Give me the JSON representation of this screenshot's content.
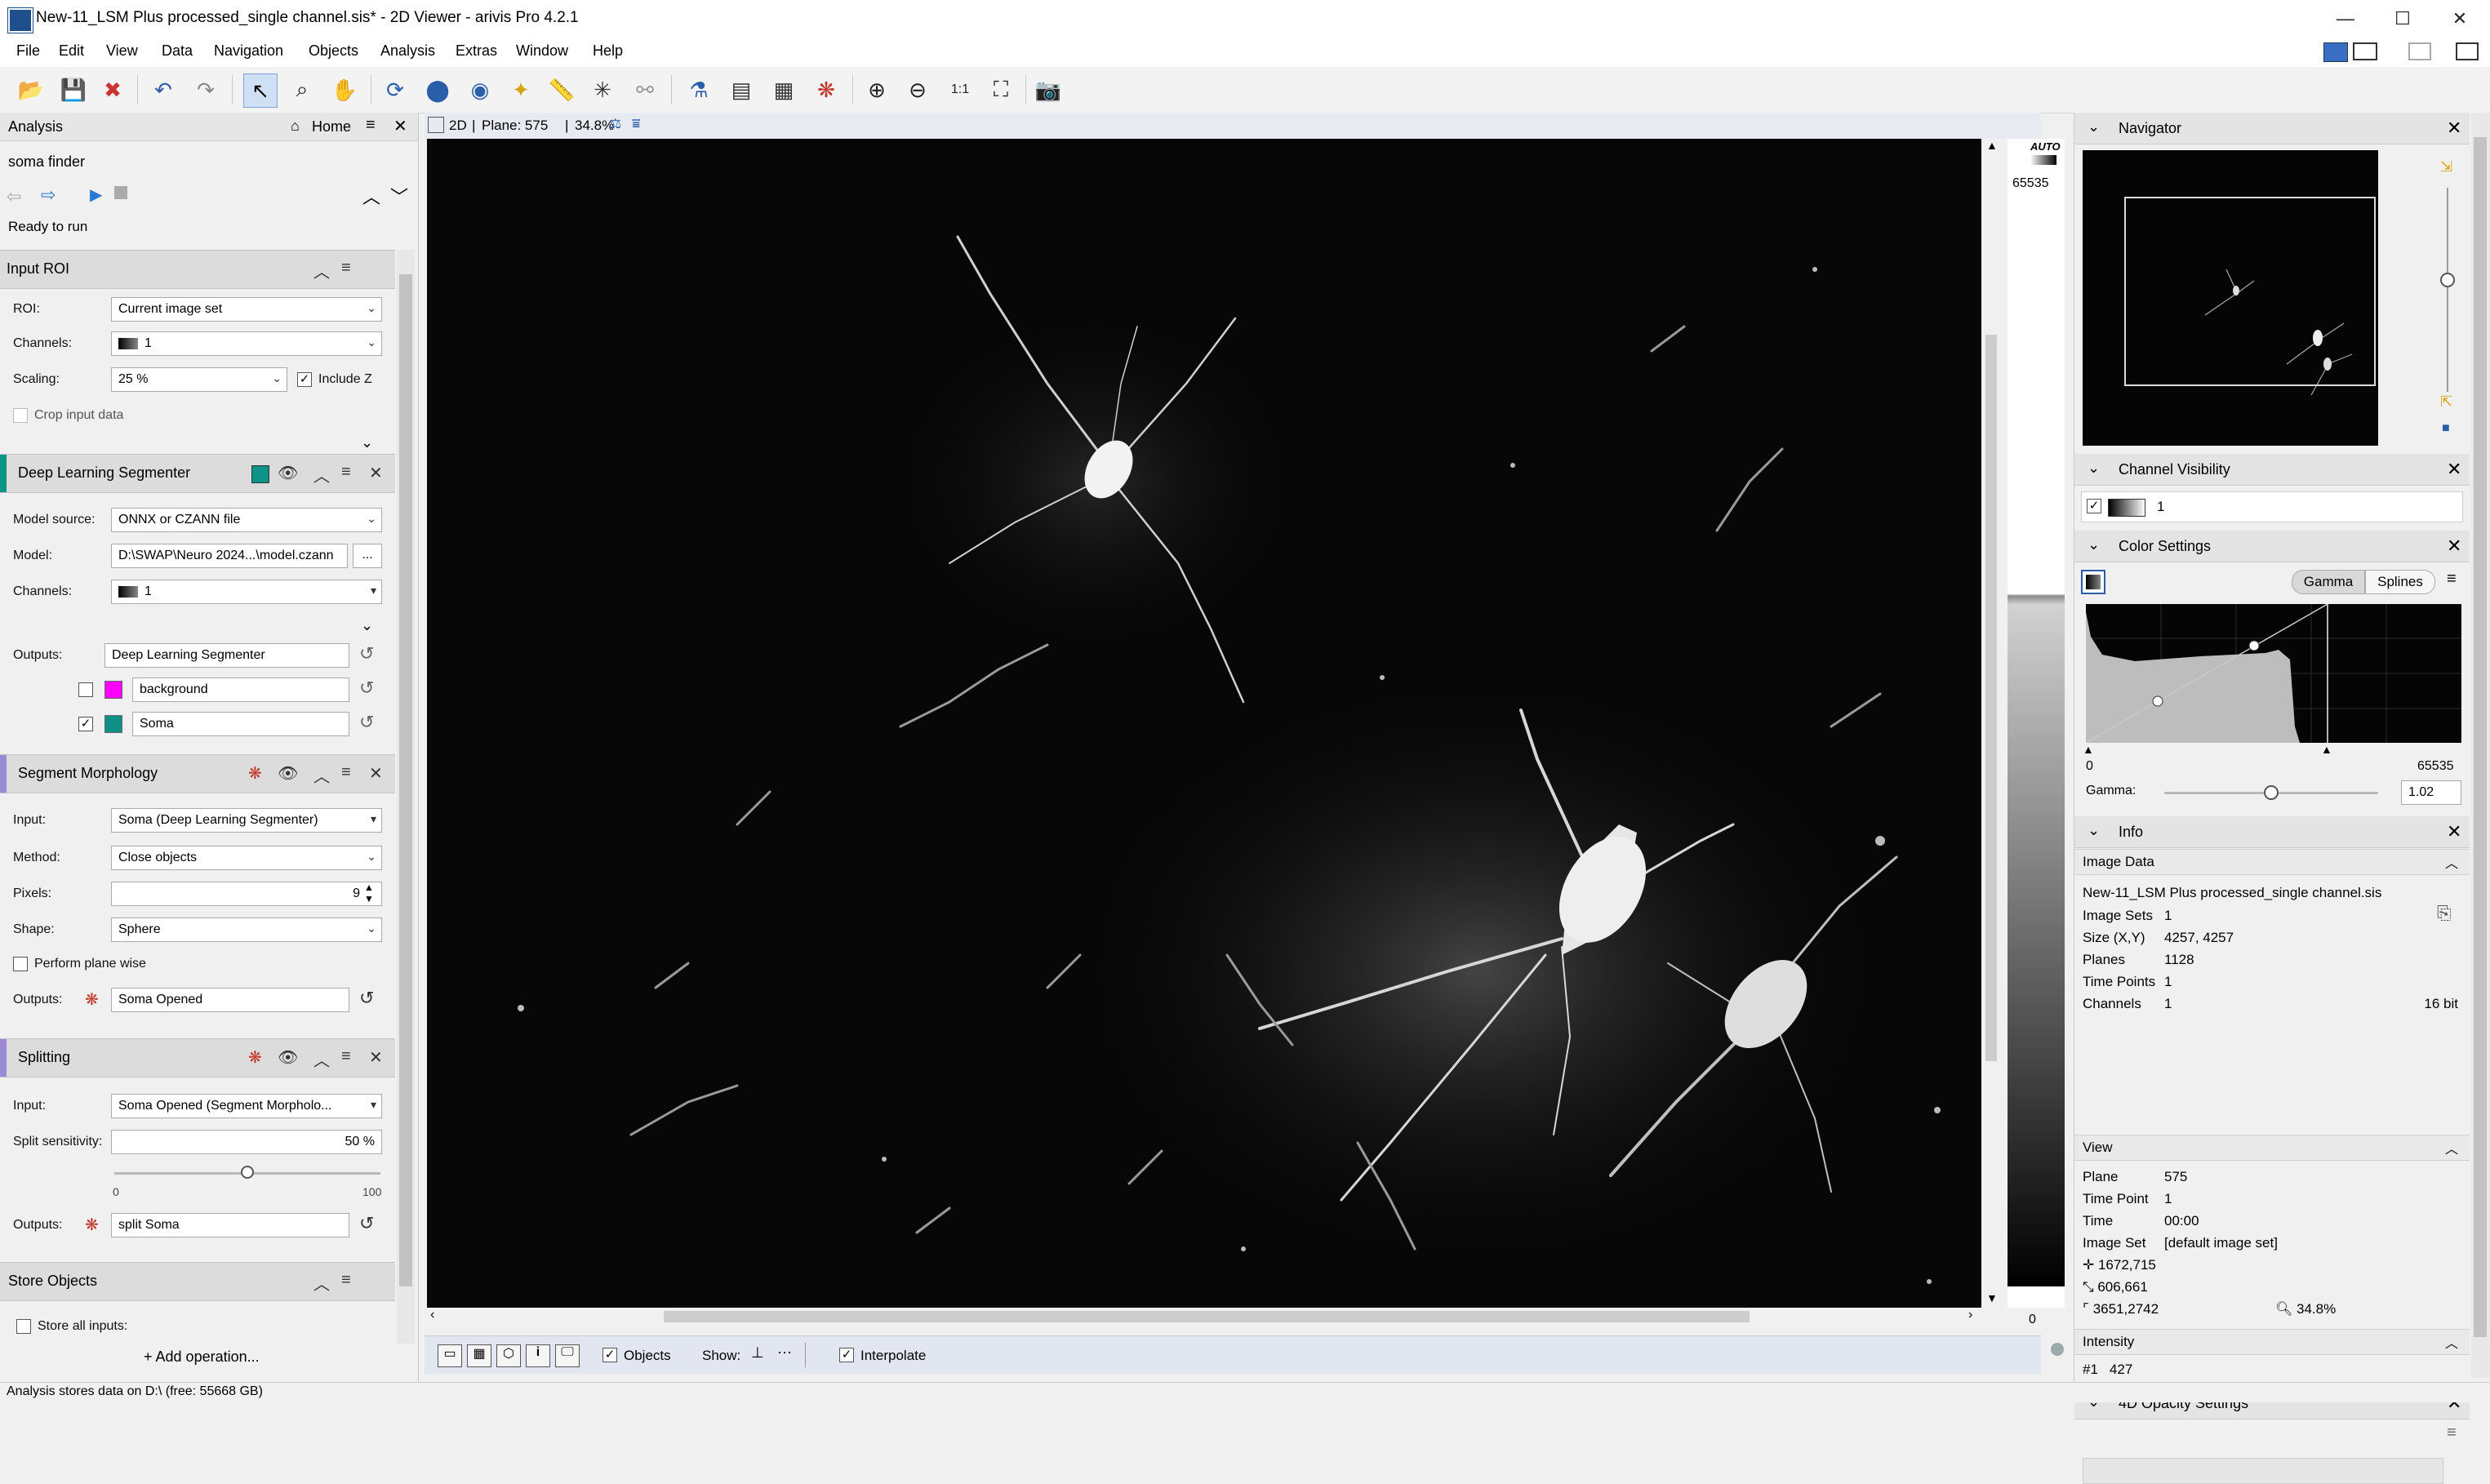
{
  "window": {
    "title": "New-11_LSM Plus processed_single channel.sis* - 2D Viewer - arivis Pro 4.2.1",
    "minimize": "—",
    "maximize": "☐",
    "close": "✕"
  },
  "menu": [
    "File",
    "Edit",
    "View",
    "Data",
    "Navigation",
    "Objects",
    "Analysis",
    "Extras",
    "Window",
    "Help"
  ],
  "analysis_panel": {
    "title": "Analysis",
    "home_label": "Home",
    "pipeline_name": "soma finder",
    "status": "Ready to run",
    "input_roi": {
      "title": "Input ROI",
      "roi_label": "ROI:",
      "roi_value": "Current image set",
      "channels_label": "Channels:",
      "channels_value": "1",
      "scaling_label": "Scaling:",
      "scaling_value": "25 %",
      "include_z_label": "Include Z",
      "crop_label": "Crop input data"
    },
    "deep_learning": {
      "title": "Deep Learning Segmenter",
      "accent": "#0d9488",
      "model_source_label": "Model source:",
      "model_source_value": "ONNX or CZANN file",
      "model_label": "Model:",
      "model_value": "D:\\SWAP\\Neuro 2024...\\model.czann",
      "browse": "...",
      "channels_label": "Channels:",
      "channels_value": "1",
      "outputs_label": "Outputs:",
      "outputs_value": "Deep Learning Segmenter",
      "class1": "background",
      "class1_color": "#ff00ff",
      "class2": "Soma",
      "class2_color": "#0f8f86"
    },
    "segment_morphology": {
      "title": "Segment Morphology",
      "input_label": "Input:",
      "input_value": "Soma (Deep Learning Segmenter)",
      "method_label": "Method:",
      "method_value": "Close objects",
      "pixels_label": "Pixels:",
      "pixels_value": "9",
      "shape_label": "Shape:",
      "shape_value": "Sphere",
      "plane_wise_label": "Perform plane wise",
      "outputs_label": "Outputs:",
      "outputs_value": "Soma Opened"
    },
    "splitting": {
      "title": "Splitting",
      "input_label": "Input:",
      "input_value": "Soma Opened (Segment Morpholo...",
      "sensitivity_label": "Split sensitivity:",
      "sensitivity_value": "50 %",
      "sensitivity_fraction": 0.5,
      "slider_min": "0",
      "slider_max": "100",
      "outputs_label": "Outputs:",
      "outputs_value": "split Soma"
    },
    "store_objects": {
      "title": "Store Objects",
      "store_all_label": "Store all inputs:"
    },
    "add_operation": "Add operation..."
  },
  "viewer": {
    "mode": "2D",
    "plane_info": "Plane: 575",
    "zoom_info": "34.8%",
    "lut_auto": "AUTO",
    "lut_max": "65535",
    "lut_min": "0",
    "objects_label": "Objects",
    "show_label": "Show:",
    "interpolate_label": "Interpolate"
  },
  "navigator": {
    "title": "Navigator"
  },
  "channel_visibility": {
    "title": "Channel Visibility",
    "channel": "1"
  },
  "color_settings": {
    "title": "Color Settings",
    "gamma_tab": "Gamma",
    "splines_tab": "Splines",
    "range_min": "0",
    "range_max": "65535",
    "gamma_label": "Gamma:",
    "gamma_value": "1.02"
  },
  "info": {
    "title": "Info",
    "image_data_title": "Image Data",
    "filename": "New-11_LSM Plus processed_single channel.sis",
    "rows": [
      {
        "k": "Image Sets",
        "v": "1"
      },
      {
        "k": "Size (X,Y)",
        "v": "4257, 4257"
      },
      {
        "k": "Planes",
        "v": "1128"
      },
      {
        "k": "Time Points",
        "v": "1"
      },
      {
        "k": "Channels",
        "v": "1"
      }
    ],
    "bitdepth": "16 bit",
    "view_title": "View",
    "view_rows": [
      {
        "k": "Plane",
        "v": "575"
      },
      {
        "k": "Time Point",
        "v": "1"
      },
      {
        "k": "Time",
        "v": "00:00"
      },
      {
        "k": "Image Set",
        "v": "[default image set]"
      }
    ],
    "coord1": "1672,715",
    "coord2": "606,661",
    "coord3": "3651,2742",
    "zoom": "34.8%",
    "intensity_title": "Intensity",
    "intensity_channel": "#1",
    "intensity_value": "427"
  },
  "opacity": {
    "title": "4D Opacity Settings"
  },
  "statusbar": {
    "text": "Analysis stores data on D:\\ (free: 55668 GB)"
  }
}
